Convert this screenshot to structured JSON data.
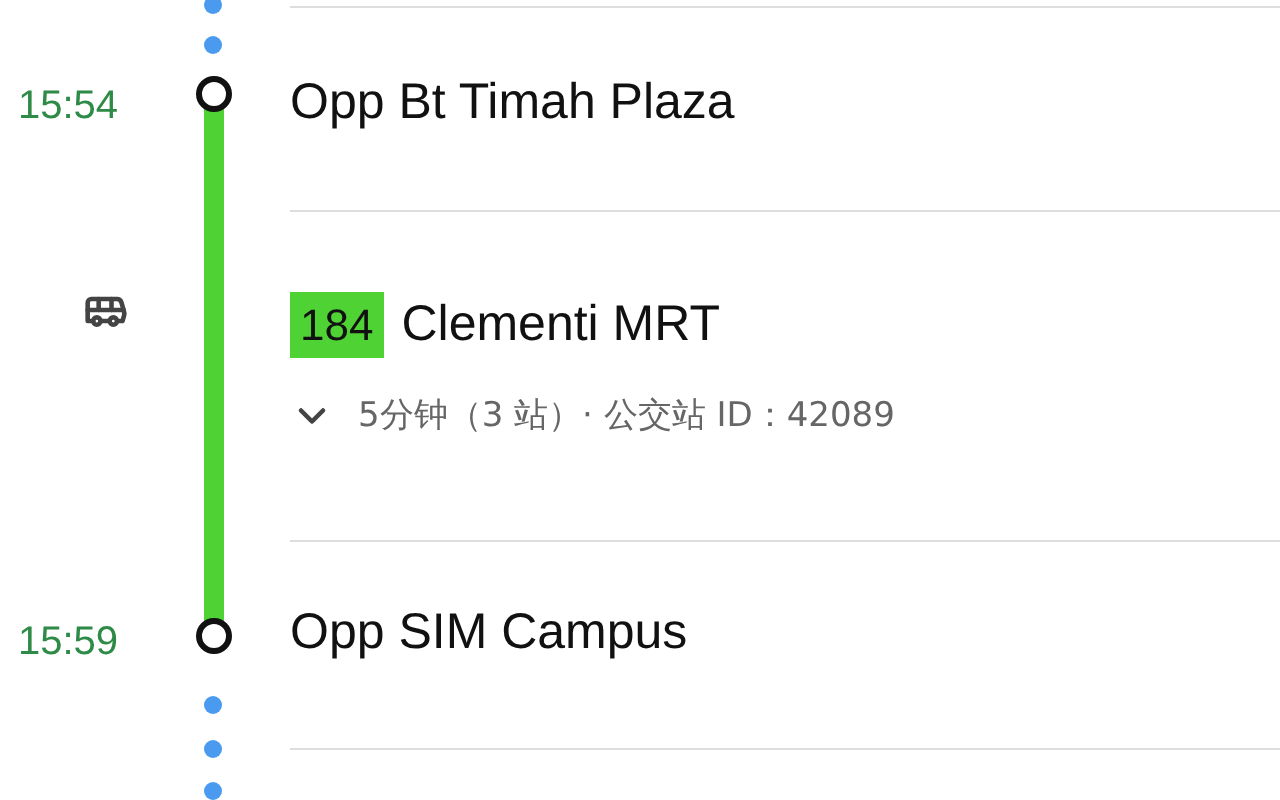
{
  "stops": [
    {
      "time": "15:54",
      "name": "Opp Bt Timah Plaza"
    },
    {
      "time": "15:59",
      "name": "Opp SIM Campus"
    }
  ],
  "transit": {
    "route": "184",
    "color": "#4fd233",
    "destination": "Clementi MRT",
    "expanded": false,
    "details": "5分钟（3 站）· 公交站 ID：42089"
  }
}
